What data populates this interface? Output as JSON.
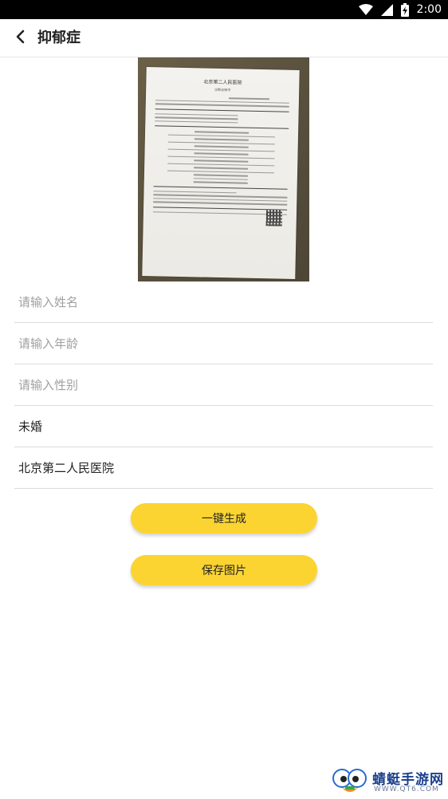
{
  "status_bar": {
    "time": "2:00",
    "icons": [
      "wifi-icon",
      "signal-icon",
      "battery-charging-icon"
    ]
  },
  "app_bar": {
    "title": "抑郁症",
    "back_icon": "back-arrow-icon"
  },
  "document_photo": {
    "paper_title": "北京第二人民医院",
    "paper_subtitle": "诊断证明书"
  },
  "form": {
    "name": {
      "value": "",
      "placeholder": "请输入姓名"
    },
    "age": {
      "value": "",
      "placeholder": "请输入年龄"
    },
    "gender": {
      "value": "",
      "placeholder": "请输入性别"
    },
    "marital_status": {
      "value": "未婚",
      "placeholder": ""
    },
    "hospital": {
      "value": "北京第二人民医院",
      "placeholder": ""
    }
  },
  "buttons": {
    "generate_label": "一键生成",
    "save_label": "保存图片"
  },
  "watermark": {
    "brand": "蜻蜓手游网",
    "url": "WWW.QT6.COM"
  },
  "colors": {
    "accent": "#fbd431",
    "status_bar": "#000000",
    "placeholder": "#a0a0a0",
    "watermark": "#1a3f8c"
  }
}
